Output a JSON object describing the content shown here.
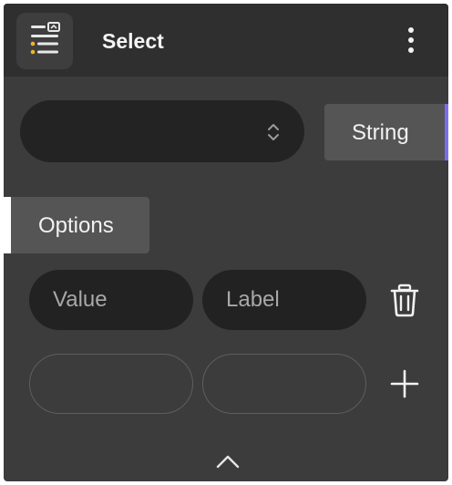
{
  "header": {
    "title": "Select",
    "node_icon": "list-select-icon",
    "menu_icon": "more-vertical-icon"
  },
  "select": {
    "value": "",
    "icon": "sort-chevrons-icon"
  },
  "type_chip": {
    "label": "String",
    "accent_color": "#7b6cf0"
  },
  "options_tab": {
    "label": "Options"
  },
  "option_rows": [
    {
      "value": "",
      "value_placeholder": "Value",
      "label": "",
      "label_placeholder": "Label",
      "action_icon": "trash-icon"
    },
    {
      "value": "",
      "value_placeholder": "",
      "label": "",
      "label_placeholder": "",
      "action_icon": "plus-icon"
    }
  ],
  "footer": {
    "collapse_icon": "chevron-up-icon"
  },
  "colors": {
    "panel": "#3c3c3c",
    "header": "#2f2f2f",
    "input_fill": "#222222",
    "chip": "#555555",
    "text": "#f2f2f2",
    "accent": "#7b6cf0",
    "node_icon_dot": "#f0b429"
  }
}
